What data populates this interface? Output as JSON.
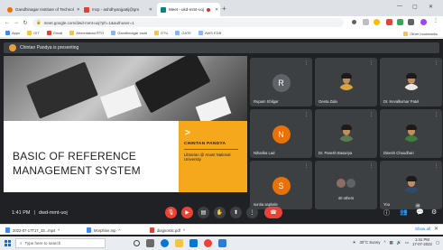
{
  "browser": {
    "tabs": [
      {
        "title": "Gandhinagar Institute of Technol"
      },
      {
        "title": "mcp - ashdhyanjpatij@gm"
      },
      {
        "title": "Meet - ukd-mmt-uoj"
      }
    ],
    "address": "meet.google.com/dwd-mmt-uoj?ph=1&authuser=1",
    "bookmarks": [
      "Apps",
      "GIT",
      "Gmail",
      "Ahmedabad RTO",
      "Gandhinagar Instit",
      "GTU",
      "GATE",
      "AWS EDB",
      "Other bookmarks"
    ]
  },
  "meet": {
    "presenting_text": "Chintan Pandya is presenting",
    "slide": {
      "title_line1": "BASIC OF REFERENCE",
      "title_line2": "MANAGEMENT SYSTEM",
      "presenter_name": "CHINTAN PANDYA",
      "presenter_role": "Librarian @ Anant National University"
    },
    "participants": [
      {
        "name": "Rupam Shilgar",
        "initial": "R",
        "color": "#5f6368"
      },
      {
        "name": "Geeta Zala",
        "initial": "",
        "color": "#8e6c4e"
      },
      {
        "name": "Dr. Kevalkumar Patel",
        "initial": "",
        "color": "#4a6b8a"
      },
      {
        "name": "Niharika Lad",
        "initial": "N",
        "color": "#e8710a"
      },
      {
        "name": "Dr. Paresh Basariya",
        "initial": "",
        "color": "#6a7f5a"
      },
      {
        "name": "Dinesh Chaudhari",
        "initial": "",
        "color": "#4c8a4c"
      },
      {
        "name": "sunita sapkale",
        "initial": "S",
        "color": "#e8710a"
      },
      {
        "name": "40 others",
        "initial": "",
        "color": "#5f6368"
      },
      {
        "name": "You",
        "initial": "",
        "color": "#2f4a6b"
      }
    ],
    "bottom": {
      "time": "1:41 PM",
      "meeting_code": "dwd-mmt-uoj",
      "people_count": "48"
    }
  },
  "downloads": {
    "items": [
      "2022-07-17T17_33...mp4",
      "Morphine.mp",
      "diagnostic.pdf"
    ],
    "show_all": "Show all"
  },
  "taskbar": {
    "search_placeholder": "Type here to search",
    "weather": "30°C Sunny",
    "time": "1:41 PM",
    "date": "17-07-2022"
  }
}
